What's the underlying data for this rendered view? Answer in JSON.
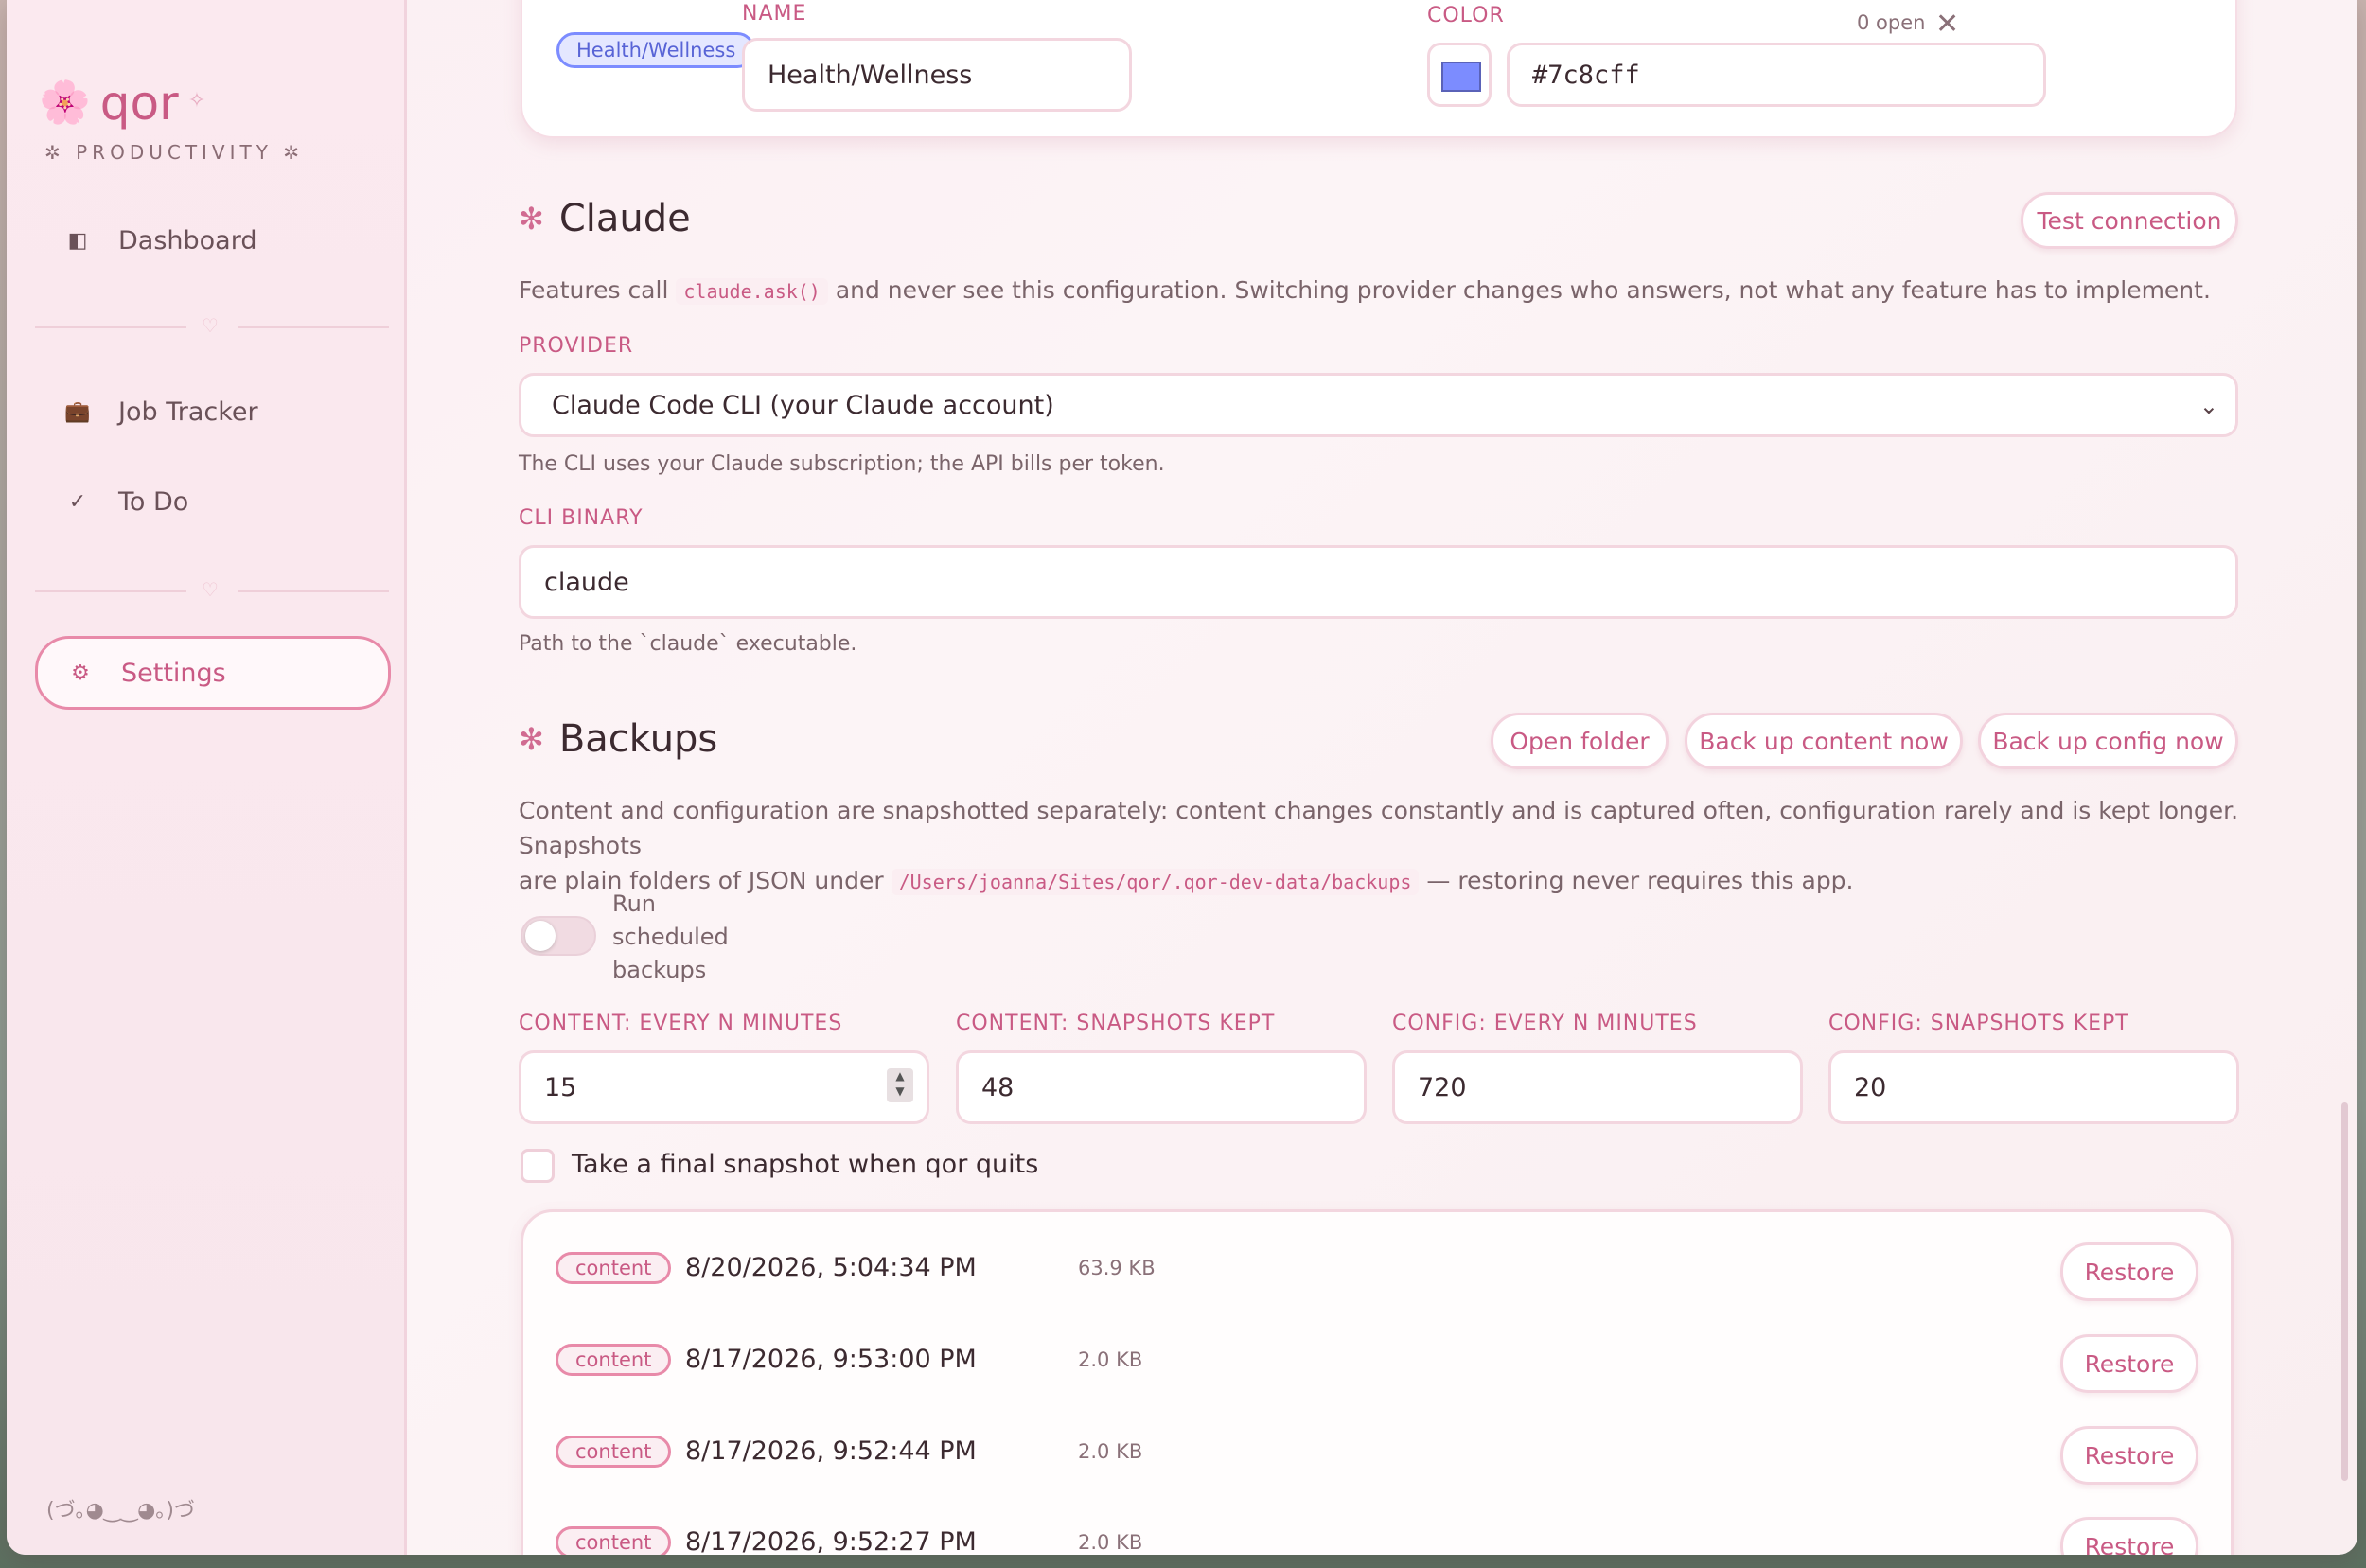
{
  "sidebar": {
    "brand_flower": "🌸",
    "brand_name": "qor",
    "brand_sparkle": "✧",
    "brand_subtitle": "✲ PRODUCTIVITY ✲",
    "items": [
      {
        "label": "Dashboard",
        "icon": "◧"
      },
      {
        "label": "Job Tracker",
        "icon": "💼"
      },
      {
        "label": "To Do",
        "icon": "✓"
      },
      {
        "label": "Settings",
        "icon": "⚙"
      }
    ],
    "divider_heart": "♡",
    "kaomoji": "(づ｡◕‿‿◕｡)づ"
  },
  "tag_editor": {
    "pill_label": "Health/Wellness",
    "name_label": "NAME",
    "name_value": "Health/Wellness",
    "color_label": "COLOR",
    "color_value": "#7c8cff",
    "open_count": "0 open",
    "close_glyph": "✕"
  },
  "claude": {
    "title": "Claude",
    "star": "✻",
    "test_button": "Test connection",
    "desc_before": "Features call",
    "desc_code": "claude.ask()",
    "desc_after": "and never see this configuration. Switching provider changes who answers, not what any feature has to implement.",
    "provider_label": "PROVIDER",
    "provider_value": "Claude Code CLI (your Claude account)",
    "provider_chevron": "⌄",
    "provider_hint": "The CLI uses your Claude subscription; the API bills per token.",
    "cli_label": "CLI BINARY",
    "cli_value": "claude",
    "cli_hint": "Path to the `claude` executable."
  },
  "backups": {
    "title": "Backups",
    "star": "✻",
    "open_folder": "Open folder",
    "backup_content": "Back up content now",
    "backup_config": "Back up config now",
    "desc_line1": "Content and configuration are snapshotted separately: content changes constantly and is captured often, configuration rarely and is kept longer. Snapshots",
    "desc_line2_before": "are plain folders of JSON under",
    "desc_path": "/Users/joanna/Sites/qor/.qor-dev-data/backups",
    "desc_line2_after": "— restoring never requires this app.",
    "toggle_label_1": "Run",
    "toggle_label_2": "scheduled",
    "toggle_label_3": "backups",
    "toggle_on": false,
    "fields": [
      {
        "label": "CONTENT: EVERY N MINUTES",
        "value": "15"
      },
      {
        "label": "CONTENT: SNAPSHOTS KEPT",
        "value": "48"
      },
      {
        "label": "CONFIG: EVERY N MINUTES",
        "value": "720"
      },
      {
        "label": "CONFIG: SNAPSHOTS KEPT",
        "value": "20"
      }
    ],
    "final_snapshot_label": "Take a final snapshot when qor quits",
    "final_snapshot_checked": false,
    "snapshots": [
      {
        "tag": "content",
        "date": "8/20/2026, 5:04:34 PM",
        "size": "63.9 KB",
        "action": "Restore"
      },
      {
        "tag": "content",
        "date": "8/17/2026, 9:53:00 PM",
        "size": "2.0 KB",
        "action": "Restore"
      },
      {
        "tag": "content",
        "date": "8/17/2026, 9:52:44 PM",
        "size": "2.0 KB",
        "action": "Restore"
      },
      {
        "tag": "content",
        "date": "8/17/2026, 9:52:27 PM",
        "size": "2.0 KB",
        "action": "Restore"
      }
    ]
  },
  "colors": {
    "accent": "#c95a84",
    "tag_color": "#7c8cff",
    "background": "#fcf4f6"
  }
}
